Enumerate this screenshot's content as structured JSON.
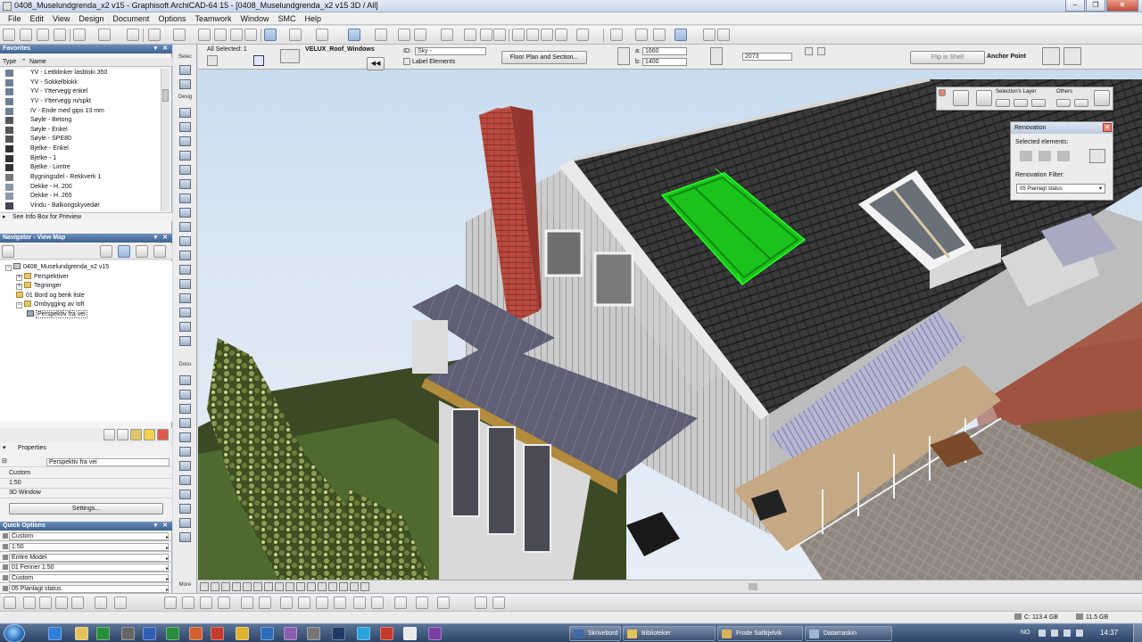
{
  "window": {
    "title": "0408_Muselundgrenda_x2 v15 - Graphisoft ArchiCAD-64 15 - [0408_Muselundgrenda_x2 v15 3D / All]",
    "minimize_icon": "minimize-icon",
    "maximize_icon": "restore-icon",
    "close_icon": "close-icon"
  },
  "menu": [
    "File",
    "Edit",
    "View",
    "Design",
    "Document",
    "Options",
    "Teamwork",
    "Window",
    "SMC",
    "Help"
  ],
  "infobox": {
    "all_selected": "All Selected: 1",
    "element_name": "VELUX_Roof_Windows",
    "id_label": "ID:",
    "id_value": "Sky -",
    "label_elements": "Label Elements",
    "floor_plan_button": "Floor Plan and Section...",
    "dim_a_label": "a:",
    "dim_a_value": "1660",
    "dim_b_label": "b:",
    "dim_b_value": "1400",
    "elevation_value": "2073",
    "flip_in_shell": "Flip in Shell",
    "anchor_point": "Anchor Point"
  },
  "favorites": {
    "header": "Favorites",
    "col_type": "Type",
    "col_name": "Name",
    "items": [
      {
        "name": "YV - Lettklinker lasbloki 350",
        "icon": "wall-icon"
      },
      {
        "name": "YV - Sokkelblokk",
        "icon": "wall-icon"
      },
      {
        "name": "YV - Yttervegg enkel",
        "icon": "wall-icon"
      },
      {
        "name": "YV - Yttervegg m/spkt",
        "icon": "wall-icon"
      },
      {
        "name": "IV - Ende med gips 13 mm",
        "icon": "wall-icon"
      },
      {
        "name": "Søyle - Betong",
        "icon": "column-icon"
      },
      {
        "name": "Søyle - Enkel",
        "icon": "column-icon"
      },
      {
        "name": "Søyle - SPE80",
        "icon": "column-icon"
      },
      {
        "name": "Bjelke - Enkel",
        "icon": "beam-icon"
      },
      {
        "name": "Bjelke - 1",
        "icon": "beam-icon"
      },
      {
        "name": "Bjelke - Limtre",
        "icon": "beam-icon"
      },
      {
        "name": "Bygningsdel - Rekkverk 1",
        "icon": "railing-icon"
      },
      {
        "name": "Dekke - H. 200",
        "icon": "slab-icon"
      },
      {
        "name": "Dekke - H. 265",
        "icon": "slab-icon"
      },
      {
        "name": "Vindu - Balkongskyvedør",
        "icon": "window-icon"
      }
    ],
    "preview_label": "See Info Box for Preview"
  },
  "navigator": {
    "header": "Navigator - View Map",
    "tree": [
      {
        "label": "0408_Muselundgrenda_x2 v15",
        "level": 0,
        "icon": "project-icon"
      },
      {
        "label": "Perspektiver",
        "level": 1,
        "icon": "folder-icon"
      },
      {
        "label": "Tegninger",
        "level": 1,
        "icon": "folder-icon"
      },
      {
        "label": "01 Bord og benk liste",
        "level": 1,
        "icon": "folder-icon"
      },
      {
        "label": "Ombygging av loft",
        "level": 1,
        "icon": "folder-icon"
      },
      {
        "label": "Perspektiv fra vei",
        "level": 2,
        "icon": "camera-icon"
      }
    ]
  },
  "properties": {
    "header": "Properties",
    "name": "Perspektiv fra vei",
    "rows": [
      "Custom",
      "1:50",
      "3D Window"
    ],
    "settings_button": "Settings..."
  },
  "quick_options": {
    "header": "Quick Options",
    "rows": [
      "Custom",
      "1:50",
      "Entire Model",
      "01 Fenner 1:50",
      "Custom",
      "05 Planlagt status"
    ]
  },
  "toolbox": {
    "select_label": "Selec",
    "design_label": "Desig",
    "document_label": "Docu",
    "more_label": "More"
  },
  "floating_palette": {
    "selections_layer": "Selection's Layer",
    "others": "Others"
  },
  "renovation": {
    "title": "Renovation",
    "selected_elements": "Selected elements:",
    "filter_label": "Renovation Filter:",
    "filter_value": "05 Planlagt status"
  },
  "status": {
    "disk_c": "C: 113.4 GB",
    "disk_other": "11.5 GB"
  },
  "taskbar": {
    "buttons": [
      "Skrivebord",
      "Biblioteker",
      "Frode Saltkjelvik",
      "Datamaskin"
    ],
    "language": "NO",
    "clock": "14:37"
  },
  "colors": {
    "selection_green": "#19d31a",
    "sky": "#d6e5f3",
    "roof_tile": "#2a2a2a",
    "siding": "#c9c9c9",
    "chimney": "#b7493e"
  }
}
